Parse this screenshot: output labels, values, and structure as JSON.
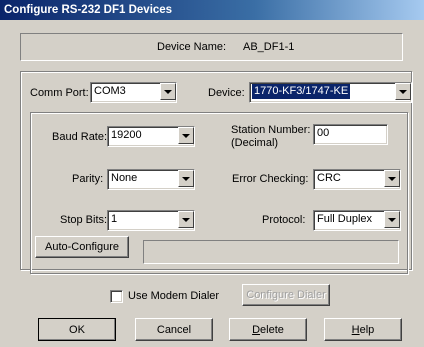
{
  "window": {
    "title": "Configure RS-232 DF1 Devices"
  },
  "device_name": {
    "label": "Device Name:",
    "value": "AB_DF1-1"
  },
  "comm_port": {
    "label": "Comm Port:",
    "value": "COM3"
  },
  "device": {
    "label": "Device:",
    "value": "1770-KF3/1747-KE"
  },
  "settings": {
    "baud_rate": {
      "label": "Baud Rate:",
      "value": "19200"
    },
    "station_number": {
      "label_line1": "Station Number:",
      "label_line2": "(Decimal)",
      "value": "00"
    },
    "parity": {
      "label": "Parity:",
      "value": "None"
    },
    "error_checking": {
      "label": "Error Checking:",
      "value": "CRC"
    },
    "stop_bits": {
      "label": "Stop Bits:",
      "value": "1"
    },
    "protocol": {
      "label": "Protocol:",
      "value": "Full Duplex"
    },
    "auto_configure_label": "Auto-Configure",
    "status_text": ""
  },
  "modem": {
    "use_modem_label": "Use Modem Dialer",
    "checked": false,
    "configure_dialer_label": "Configure Dialer"
  },
  "buttons": {
    "ok": "OK",
    "cancel": "Cancel",
    "delete_first": "D",
    "delete_rest": "elete",
    "help_first": "H",
    "help_rest": "elp"
  },
  "icons": {
    "dropdown": "chevron-down-icon"
  }
}
